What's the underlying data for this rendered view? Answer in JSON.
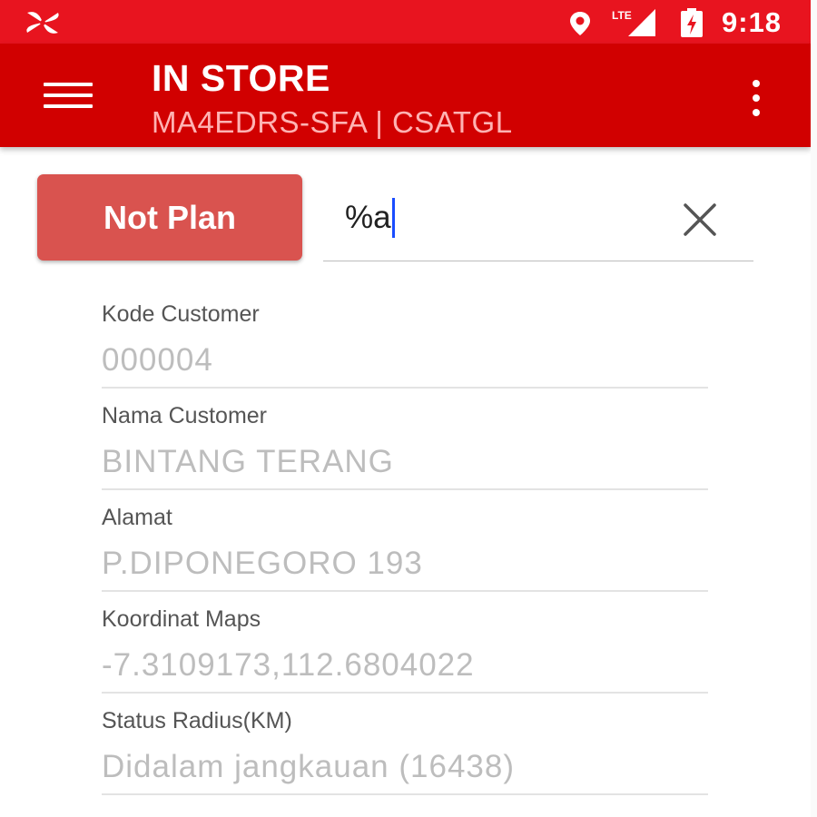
{
  "status_bar": {
    "time": "9:18",
    "network_label": "LTE",
    "icons": [
      "app-pinwheel-icon",
      "location-pin-icon",
      "lte-signal-icon",
      "battery-charging-icon"
    ]
  },
  "app_bar": {
    "title": "IN STORE",
    "subtitle": "MA4EDRS-SFA | CSATGL",
    "icons": [
      "hamburger-menu-icon",
      "overflow-menu-icon"
    ]
  },
  "actions": {
    "not_plan_label": "Not Plan"
  },
  "search": {
    "value": "%a",
    "clear_icon": "close-icon"
  },
  "fields": [
    {
      "label": "Kode Customer",
      "value": "000004"
    },
    {
      "label": "Nama Customer",
      "value": "BINTANG TERANG"
    },
    {
      "label": "Alamat",
      "value": "P.DIPONEGORO 193"
    },
    {
      "label": "Koordinat Maps",
      "value": "-7.3109173,112.6804022"
    },
    {
      "label": "Status Radius(KM)",
      "value": "Didalam jangkauan (16438)"
    }
  ],
  "colors": {
    "status_bar": "#e8141f",
    "app_bar": "#d10000",
    "button": "#d9534f",
    "caret": "#1a4dff"
  }
}
